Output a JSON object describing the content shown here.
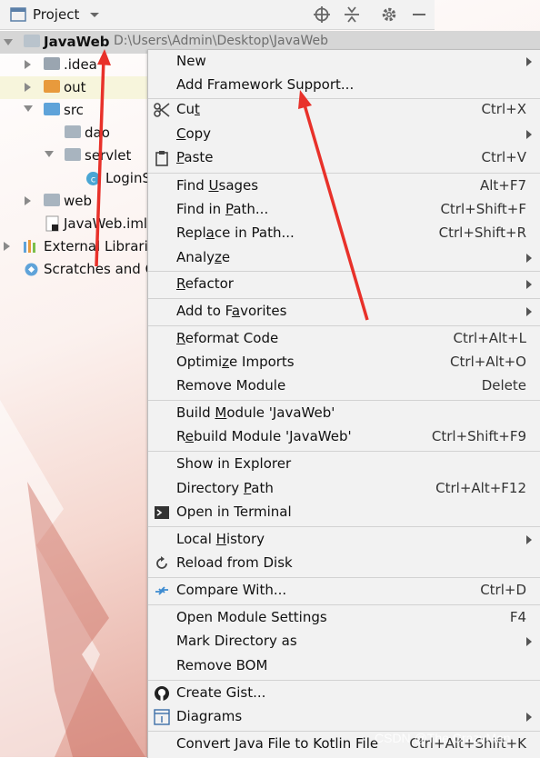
{
  "toolbar": {
    "title": "Project",
    "icons": [
      "project-view-icon",
      "dropdown-icon",
      "locate-icon",
      "collapse-icon",
      "gear-icon",
      "minimize-icon"
    ]
  },
  "tree": {
    "root": {
      "name": "JavaWeb",
      "path": "D:\\Users\\Admin\\Desktop\\JavaWeb"
    },
    "items": [
      {
        "label": ".idea"
      },
      {
        "label": "out"
      },
      {
        "label": "src"
      },
      {
        "label": "dao"
      },
      {
        "label": "servlet"
      },
      {
        "label": "LoginS"
      },
      {
        "label": "web"
      },
      {
        "label": "JavaWeb.iml"
      },
      {
        "label": "External Librarie"
      },
      {
        "label": "Scratches and C"
      }
    ]
  },
  "menu": {
    "items": [
      {
        "pre": "New",
        "u": "",
        "post": "",
        "shortcut": "",
        "submenu": true
      },
      {
        "pre": "Add Framework Support...",
        "u": "",
        "post": "",
        "shortcut": "",
        "submenu": false
      },
      {
        "pre": "Cu",
        "u": "t",
        "post": "",
        "shortcut": "Ctrl+X",
        "submenu": false
      },
      {
        "pre": "",
        "u": "C",
        "post": "opy",
        "shortcut": "",
        "submenu": true
      },
      {
        "pre": "",
        "u": "P",
        "post": "aste",
        "shortcut": "Ctrl+V",
        "submenu": false
      },
      {
        "pre": "Find ",
        "u": "U",
        "post": "sages",
        "shortcut": "Alt+F7",
        "submenu": false
      },
      {
        "pre": "Find in ",
        "u": "P",
        "post": "ath...",
        "shortcut": "Ctrl+Shift+F",
        "submenu": false
      },
      {
        "pre": "Repl",
        "u": "a",
        "post": "ce in Path...",
        "shortcut": "Ctrl+Shift+R",
        "submenu": false
      },
      {
        "pre": "Analy",
        "u": "z",
        "post": "e",
        "shortcut": "",
        "submenu": true
      },
      {
        "pre": "",
        "u": "R",
        "post": "efactor",
        "shortcut": "",
        "submenu": true
      },
      {
        "pre": "Add to F",
        "u": "a",
        "post": "vorites",
        "shortcut": "",
        "submenu": true
      },
      {
        "pre": "",
        "u": "R",
        "post": "eformat Code",
        "shortcut": "Ctrl+Alt+L",
        "submenu": false
      },
      {
        "pre": "Optimi",
        "u": "z",
        "post": "e Imports",
        "shortcut": "Ctrl+Alt+O",
        "submenu": false
      },
      {
        "pre": "Remove Module",
        "u": "",
        "post": "",
        "shortcut": "Delete",
        "submenu": false
      },
      {
        "pre": "Build ",
        "u": "M",
        "post": "odule 'JavaWeb'",
        "shortcut": "",
        "submenu": false
      },
      {
        "pre": "R",
        "u": "e",
        "post": "build Module 'JavaWeb'",
        "shortcut": "Ctrl+Shift+F9",
        "submenu": false
      },
      {
        "pre": "Show in Explorer",
        "u": "",
        "post": "",
        "shortcut": "",
        "submenu": false
      },
      {
        "pre": "Directory ",
        "u": "P",
        "post": "ath",
        "shortcut": "Ctrl+Alt+F12",
        "submenu": false
      },
      {
        "pre": "Open in Terminal",
        "u": "",
        "post": "",
        "shortcut": "",
        "submenu": false
      },
      {
        "pre": "Local ",
        "u": "H",
        "post": "istory",
        "shortcut": "",
        "submenu": true
      },
      {
        "pre": "Reload from Disk",
        "u": "",
        "post": "",
        "shortcut": "",
        "submenu": false
      },
      {
        "pre": "Compare With...",
        "u": "",
        "post": "",
        "shortcut": "Ctrl+D",
        "submenu": false
      },
      {
        "pre": "Open Module Settings",
        "u": "",
        "post": "",
        "shortcut": "F4",
        "submenu": false
      },
      {
        "pre": "Mark Directory as",
        "u": "",
        "post": "",
        "shortcut": "",
        "submenu": true
      },
      {
        "pre": "Remove BOM",
        "u": "",
        "post": "",
        "shortcut": "",
        "submenu": false
      },
      {
        "pre": "Create Gist...",
        "u": "",
        "post": "",
        "shortcut": "",
        "submenu": false
      },
      {
        "pre": "Diagrams",
        "u": "",
        "post": "",
        "shortcut": "",
        "submenu": true
      },
      {
        "pre": "Convert Java File to Kotlin File",
        "u": "",
        "post": "",
        "shortcut": "Ctrl+Alt+Shift+K",
        "submenu": false
      }
    ]
  },
  "watermark": "CSDN @The CrazyMan",
  "colors": {
    "annotation_arrow": "#e8312a",
    "menu_bg": "#f2f2f2",
    "folder_blue": "#5fa3d9",
    "folder_orange": "#e89a3c"
  }
}
